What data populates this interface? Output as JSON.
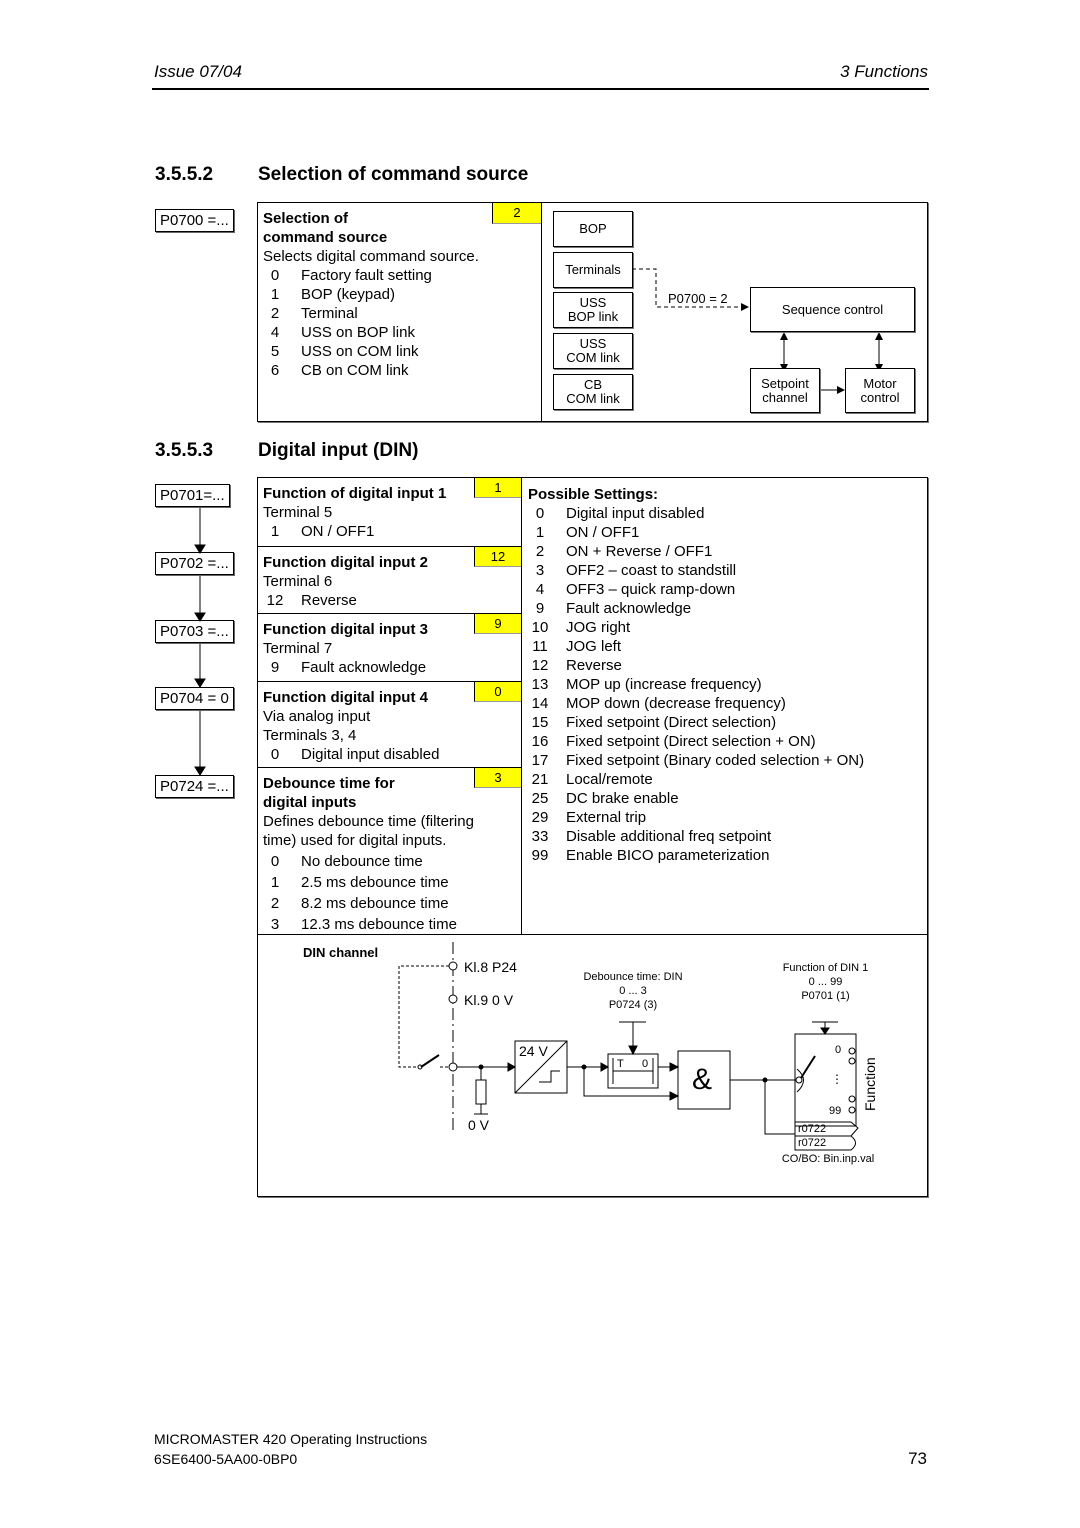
{
  "header": {
    "issue": "Issue 07/04",
    "chapter": "3  Functions"
  },
  "section_command": {
    "number": "3.5.5.2",
    "title": "Selection of command source",
    "param_label": "P0700 =...",
    "box_title_1": "Selection of",
    "box_title_2": "command source",
    "default_value": "2",
    "description": "Selects digital command source.",
    "options": [
      {
        "value": "0",
        "label": "Factory fault setting"
      },
      {
        "value": "1",
        "label": "BOP (keypad)"
      },
      {
        "value": "2",
        "label": "Terminal"
      },
      {
        "value": "4",
        "label": "USS on BOP link"
      },
      {
        "value": "5",
        "label": "USS on COM link"
      },
      {
        "value": "6",
        "label": "CB on COM link"
      }
    ],
    "diagram": {
      "sources": [
        {
          "line1": "BOP",
          "line2": ""
        },
        {
          "line1": "Terminals",
          "line2": ""
        },
        {
          "line1": "USS",
          "line2": "BOP link"
        },
        {
          "line1": "USS",
          "line2": "COM link"
        },
        {
          "line1": "CB",
          "line2": "COM link"
        }
      ],
      "selector_label": "P0700 = 2",
      "sequence_control": "Sequence control",
      "setpoint_line1": "Setpoint",
      "setpoint_line2": "channel",
      "motor_line1": "Motor",
      "motor_line2": "control"
    }
  },
  "section_din": {
    "number": "3.5.5.3",
    "title": "Digital input (DIN)",
    "param_chain": [
      "P0701=...",
      "P0702 =...",
      "P0703 =...",
      "P0704 = 0",
      "P0724 =..."
    ],
    "params": [
      {
        "title": "Function of digital input 1",
        "default": "1",
        "lines": [
          "Terminal 5"
        ],
        "options": [
          {
            "value": "1",
            "label": "ON / OFF1"
          }
        ]
      },
      {
        "title": "Function digital input 2",
        "default": "12",
        "lines": [
          "Terminal 6"
        ],
        "options": [
          {
            "value": "12",
            "label": "Reverse"
          }
        ]
      },
      {
        "title": "Function digital input 3",
        "default": "9",
        "lines": [
          "Terminal 7"
        ],
        "options": [
          {
            "value": "9",
            "label": "Fault acknowledge"
          }
        ]
      },
      {
        "title": "Function digital input 4",
        "default": "0",
        "lines": [
          "Via analog input",
          "Terminals 3, 4"
        ],
        "options": [
          {
            "value": "0",
            "label": "Digital input disabled"
          }
        ]
      }
    ],
    "debounce": {
      "title_1": "Debounce time for",
      "title_2": "digital inputs",
      "default": "3",
      "desc_1": "Defines debounce time (filtering",
      "desc_2": "time) used for digital inputs.",
      "options": [
        {
          "value": "0",
          "label": "No debounce time"
        },
        {
          "value": "1",
          "label": "2.5 ms debounce time"
        },
        {
          "value": "2",
          "label": "8.2 ms debounce time"
        },
        {
          "value": "3",
          "label": "12.3 ms debounce time"
        }
      ]
    },
    "possible_settings_title": "Possible Settings:",
    "possible_settings": [
      {
        "value": "0",
        "label": "Digital input disabled"
      },
      {
        "value": "1",
        "label": "ON / OFF1"
      },
      {
        "value": "2",
        "label": "ON + Reverse / OFF1"
      },
      {
        "value": "3",
        "label": "OFF2 – coast to standstill"
      },
      {
        "value": "4",
        "label": "OFF3 – quick ramp-down"
      },
      {
        "value": "9",
        "label": "Fault acknowledge"
      },
      {
        "value": "10",
        "label": "JOG right"
      },
      {
        "value": "11",
        "label": "JOG left"
      },
      {
        "value": "12",
        "label": "Reverse"
      },
      {
        "value": "13",
        "label": "MOP up (increase frequency)"
      },
      {
        "value": "14",
        "label": "MOP down (decrease frequency)"
      },
      {
        "value": "15",
        "label": "Fixed setpoint (Direct selection)"
      },
      {
        "value": "16",
        "label": "Fixed setpoint (Direct selection + ON)"
      },
      {
        "value": "17",
        "label": "Fixed setpoint (Binary coded selection + ON)"
      },
      {
        "value": "21",
        "label": "Local/remote"
      },
      {
        "value": "25",
        "label": "DC brake enable"
      },
      {
        "value": "29",
        "label": "External trip"
      },
      {
        "value": "33",
        "label": "Disable additional freq setpoint"
      },
      {
        "value": "99",
        "label": "Enable BICO parameterization"
      }
    ],
    "channel": {
      "title": "DIN channel",
      "kl8": "Kl.8  P24",
      "kl9": "Kl.9  0 V",
      "zero_v": "0 V",
      "converter_label": "24 V",
      "debounce_title": "Debounce time: DIN",
      "debounce_range": "0 ... 3",
      "debounce_param": "P0724 (3)",
      "timer_t": "T",
      "timer_0": "0",
      "and_symbol": "&",
      "func_title": "Function of DIN 1",
      "func_range": "0 ... 99",
      "func_param": "P0701 (1)",
      "selector_0": "0",
      "selector_dots": "⋮",
      "selector_99": "99",
      "function_label": "Function",
      "connector_1": "r0722",
      "connector_2": "r0722",
      "connector_caption": "CO/BO: Bin.inp.val"
    }
  },
  "footer": {
    "product": "MICROMASTER 420    Operating Instructions",
    "order_no": "6SE6400-5AA00-0BP0",
    "page": "73"
  }
}
